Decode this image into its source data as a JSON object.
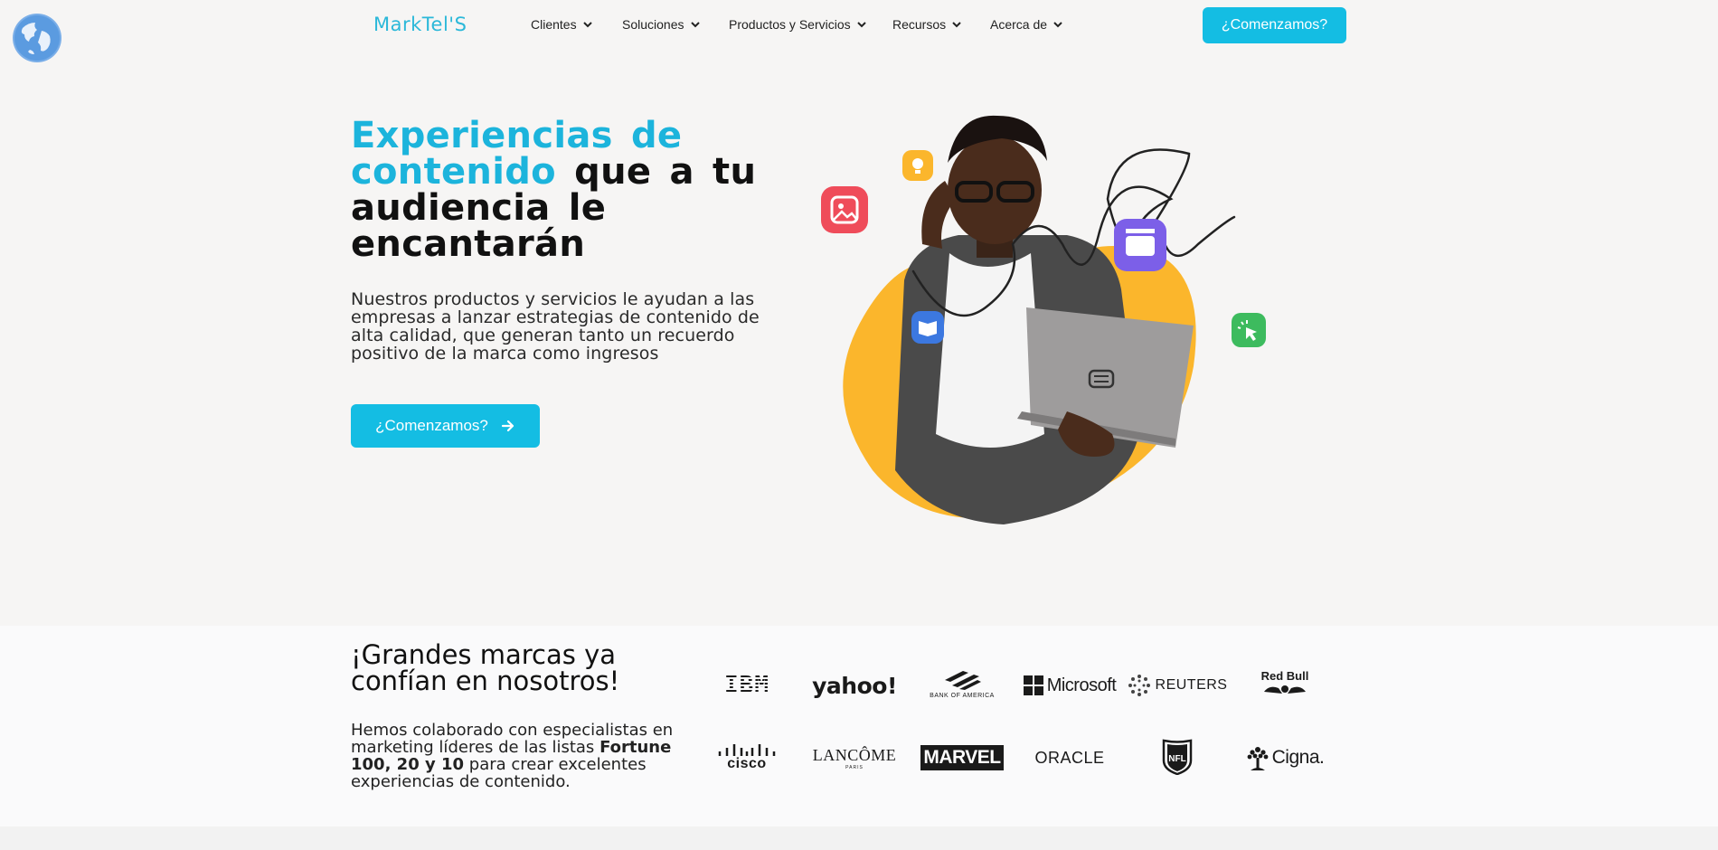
{
  "header": {
    "logo": "MarkTel'S",
    "nav": [
      "Clientes",
      "Soluciones",
      "Productos y Servicios",
      "Recursos",
      "Acerca de"
    ],
    "cta": "¿Comenzamos?"
  },
  "hero": {
    "title_highlight": "Experiencias de contenido",
    "title_rest": "que a tu audiencia le encantarán",
    "description": "Nuestros productos y servicios le ayudan a las empresas a lanzar estrategias de contenido de alta calidad, que generan tanto un recuerdo positivo de la marca como ingresos",
    "cta": "¿Comenzamos?"
  },
  "brands": {
    "title": "¡Grandes marcas ya confían en nosotros!",
    "desc_start": "Hemos colaborado con especialistas en marketing líderes de las listas",
    "desc_bold": "Fortune 100, 20 y 10",
    "desc_end": "para crear excelentes experiencias de contenido.",
    "logos": [
      "IBM",
      "yahoo!",
      "BANK OF AMERICA",
      "Microsoft",
      "REUTERS",
      "Red Bull",
      "cisco",
      "LANCÔME",
      "PARIS",
      "MARVEL",
      "ORACLE",
      "NFL",
      "Cigna."
    ]
  },
  "colors": {
    "accent": "#14bde3",
    "heading_accent": "#1cb4dc",
    "blob": "#fbb62c",
    "background": "#f6f5f4"
  }
}
